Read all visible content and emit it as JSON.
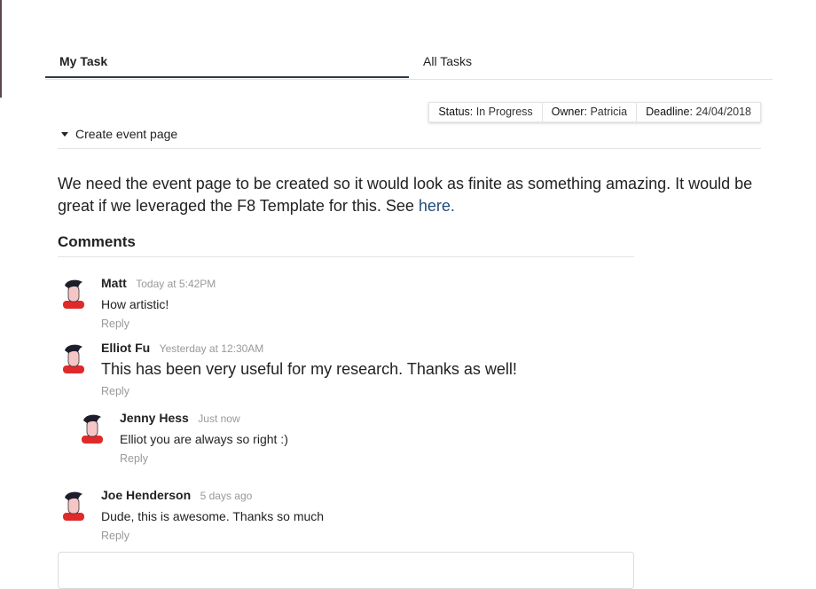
{
  "tabs": [
    {
      "label": "My Task",
      "active": true
    },
    {
      "label": "All Tasks",
      "active": false
    }
  ],
  "meta": {
    "status_label": "Status:",
    "status_value": "In Progress",
    "owner_label": "Owner:",
    "owner_value": "Patricia",
    "deadline_label": "Deadline:",
    "deadline_value": "24/04/2018"
  },
  "task": {
    "title": "Create event page",
    "description": "We need the event page to be created so it would look as finite as something amazing. It would be great if we leveraged the F8 Template for this. See",
    "link_text": "here."
  },
  "comments_header": "Comments",
  "comments": [
    {
      "author": "Matt",
      "date": "Today at 5:42PM",
      "text": "How artistic!",
      "reply": "Reply"
    },
    {
      "author": "Elliot Fu",
      "date": "Yesterday at 12:30AM",
      "text": "This has been very useful for my research. Thanks as well!",
      "reply": "Reply"
    },
    {
      "author": "Jenny Hess",
      "date": "Just now",
      "text": "Elliot you are always so right :)",
      "reply": "Reply"
    },
    {
      "author": "Joe Henderson",
      "date": "5 days ago",
      "text": "Dude, this is awesome. Thanks so much",
      "reply": "Reply"
    }
  ],
  "colors": {
    "active_tab_border": "#2a3a48",
    "link": "#1e4b7a",
    "avatar_shirt": "#e02a2a",
    "avatar_hair": "#1d1d2b",
    "avatar_skin": "#f6c6c6"
  }
}
